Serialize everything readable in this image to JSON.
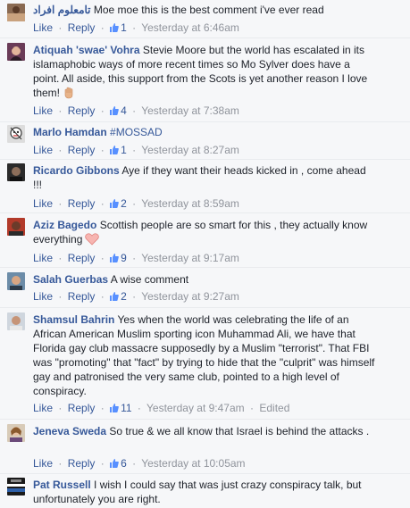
{
  "colors": {
    "link": "#365899",
    "meta": "#90949c",
    "text": "#1d2129",
    "background": "#f6f7f9"
  },
  "actions": {
    "like": "Like",
    "reply": "Reply",
    "separator": "·"
  },
  "comments": [
    {
      "author": "تامعلوم افراد",
      "tag": "",
      "text": "Moe moe this is the best comment i've ever read",
      "emoji": "",
      "likes": "1",
      "time": "Yesterday at 6:46am",
      "edited": "",
      "avatar": "avatar-0"
    },
    {
      "author": "Atiquah 'swae' Vohra",
      "tag": "",
      "text": "Stevie Moore but the world has escalated in its islamaphobic ways of more recent times so Mo Sylver does have a point. All aside, this support from the Scots is yet another reason I love them!",
      "emoji": "waving-hand-icon",
      "likes": "4",
      "time": "Yesterday at 7:38am",
      "edited": "",
      "avatar": "avatar-1"
    },
    {
      "author": "Marlo Hamdan",
      "tag": "#MOSSAD",
      "text": "",
      "emoji": "",
      "likes": "1",
      "time": "Yesterday at 8:27am",
      "edited": "",
      "avatar": "avatar-2"
    },
    {
      "author": "Ricardo Gibbons",
      "tag": "",
      "text": "Aye if they want their heads kicked in , come ahead !!!",
      "emoji": "",
      "likes": "2",
      "time": "Yesterday at 8:59am",
      "edited": "",
      "avatar": "avatar-3"
    },
    {
      "author": "Aziz Bagedo",
      "tag": "",
      "text": "Scottish people are so smart for this , they actually know everything",
      "emoji": "heart-icon",
      "likes": "9",
      "time": "Yesterday at 9:17am",
      "edited": "",
      "avatar": "avatar-4"
    },
    {
      "author": "Salah Guerbas",
      "tag": "",
      "text": "A wise comment",
      "emoji": "",
      "likes": "2",
      "time": "Yesterday at 9:27am",
      "edited": "",
      "avatar": "avatar-5"
    },
    {
      "author": "Shamsul Bahrin",
      "tag": "",
      "text": "Yes when the world was celebrating the life of an African American Muslim sporting icon Muhammad Ali, we have that Florida gay club massacre supposedly by a Muslim \"terrorist\". That FBI was \"promoting\" that \"fact\" by trying to hide that the \"culprit\" was himself gay and patronised the very same club, pointed to a high level of conspiracy.",
      "emoji": "",
      "likes": "11",
      "time": "Yesterday at 9:47am",
      "edited": "Edited",
      "avatar": "avatar-6"
    },
    {
      "author": "Jeneva Sweda",
      "tag": "",
      "text": "So true & we all know that Israel is behind the attacks .",
      "emoji": "",
      "likes": "6",
      "time": "Yesterday at 10:05am",
      "edited": "",
      "avatar": "avatar-7"
    },
    {
      "author": "Pat Russell",
      "tag": "",
      "text": "I wish I could say that was just crazy conspiracy talk, but unfortunately you are right.",
      "emoji": "",
      "likes": "",
      "time": "",
      "edited": "",
      "avatar": "avatar-8"
    }
  ]
}
